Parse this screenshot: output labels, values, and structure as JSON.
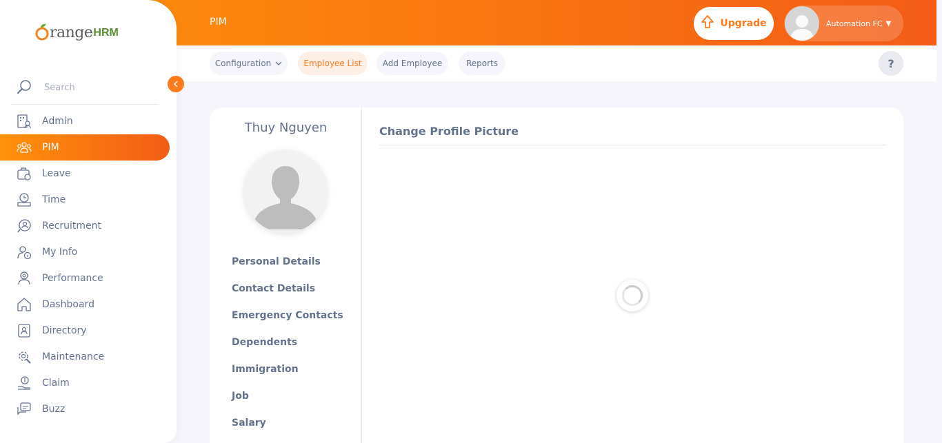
{
  "header": {
    "title": "PIM",
    "upgrade_label": "Upgrade",
    "user_name": "Automation FC"
  },
  "subnav": {
    "items": [
      {
        "label": "Configuration"
      },
      {
        "label": "Employee List"
      },
      {
        "label": "Add Employee"
      },
      {
        "label": "Reports"
      }
    ],
    "help": "?"
  },
  "sidebar": {
    "logo_text": "range",
    "logo_hrm": "HRM",
    "search_placeholder": "Search",
    "items": [
      {
        "label": "Admin",
        "icon": "admin-icon"
      },
      {
        "label": "PIM",
        "icon": "pim-icon"
      },
      {
        "label": "Leave",
        "icon": "leave-icon"
      },
      {
        "label": "Time",
        "icon": "time-icon"
      },
      {
        "label": "Recruitment",
        "icon": "recruitment-icon"
      },
      {
        "label": "My Info",
        "icon": "my-info-icon"
      },
      {
        "label": "Performance",
        "icon": "performance-icon"
      },
      {
        "label": "Dashboard",
        "icon": "dashboard-icon"
      },
      {
        "label": "Directory",
        "icon": "directory-icon"
      },
      {
        "label": "Maintenance",
        "icon": "maintenance-icon"
      },
      {
        "label": "Claim",
        "icon": "claim-icon"
      },
      {
        "label": "Buzz",
        "icon": "buzz-icon"
      }
    ],
    "active": "PIM"
  },
  "profile": {
    "name": "Thuy Nguyen",
    "tabs": [
      {
        "label": "Personal Details"
      },
      {
        "label": "Contact Details"
      },
      {
        "label": "Emergency Contacts"
      },
      {
        "label": "Dependents"
      },
      {
        "label": "Immigration"
      },
      {
        "label": "Job"
      },
      {
        "label": "Salary"
      }
    ]
  },
  "main": {
    "section_title": "Change Profile Picture"
  },
  "colors": {
    "brand_orange": "#ff7b1d",
    "text": "#64728c"
  }
}
